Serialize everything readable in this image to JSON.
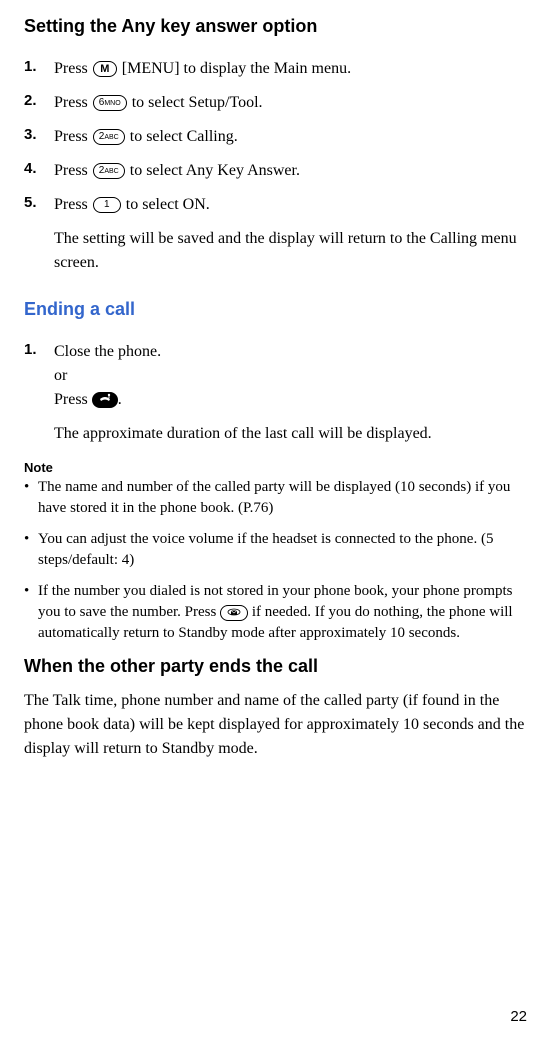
{
  "title_any_key": "Setting the Any key answer option",
  "steps_any_key": [
    {
      "num": "1.",
      "pre": "Press ",
      "key": "M",
      "keyclass": "key-m",
      "post": " [MENU] to display the Main menu."
    },
    {
      "num": "2.",
      "pre": "Press ",
      "key": "6MNO",
      "keyclass": "",
      "post": " to select Setup/Tool."
    },
    {
      "num": "3.",
      "pre": "Press ",
      "key": "2ABC",
      "keyclass": "",
      "post": " to select Calling."
    },
    {
      "num": "4.",
      "pre": "Press ",
      "key": "2ABC",
      "keyclass": "",
      "post": " to select Any Key Answer."
    },
    {
      "num": "5.",
      "pre": "Press ",
      "key": "1",
      "keyclass": "",
      "post": " to select ON."
    }
  ],
  "any_key_tail": "The setting will be saved and the display will return to the Calling menu screen.",
  "title_ending": "Ending a call",
  "ending_step_num": "1.",
  "ending_line1": "Close the phone.",
  "ending_line2a": "or",
  "ending_line2b_pre": "Press ",
  "ending_line2b_post": ".",
  "ending_result": "The approximate duration of the last call will be displayed.",
  "note_heading": "Note",
  "notes": [
    "The name and number of the called party will be displayed (10 seconds) if you have stored it in the phone book. (P.76)",
    "You can adjust the voice volume if the headset is connected to the phone. (5 steps/default: 4)"
  ],
  "note3_pre": "If the number you dialed is not stored in your phone book, your phone prompts you to save the number. Press ",
  "note3_post": " if needed. If you do nothing, the phone will automatically return to Standby mode after approximately 10 seconds.",
  "title_other_party": "When the other party ends the call",
  "other_party_body": "The Talk time, phone number and name of the called party (if found in the phone book data) will be kept displayed for approximately 10 seconds and the display will return to Standby mode.",
  "page_number": "22",
  "bullet": "•"
}
